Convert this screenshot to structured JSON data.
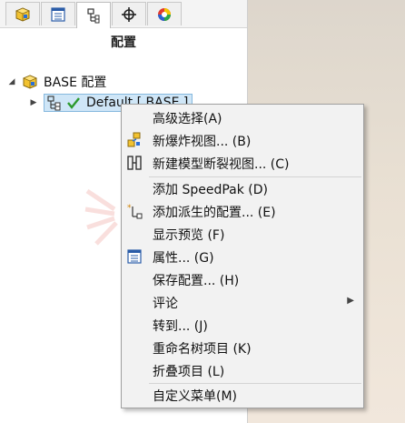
{
  "panel": {
    "title": "配置",
    "tabs": [
      {
        "icon": "feature-manager-icon"
      },
      {
        "icon": "property-manager-icon"
      },
      {
        "icon": "configuration-manager-icon",
        "active": true
      },
      {
        "icon": "dimxpert-icon"
      },
      {
        "icon": "display-manager-icon"
      }
    ]
  },
  "tree": {
    "root_label": "BASE 配置",
    "child_label": "Default [ BASE ]"
  },
  "menu": {
    "items": [
      {
        "label": "高级选择(A)",
        "icon": ""
      },
      {
        "label": "新爆炸视图... (B)",
        "icon": "explode-view-icon"
      },
      {
        "label": "新建模型断裂视图... (C)",
        "icon": "break-view-icon"
      },
      {
        "label": "添加 SpeedPak (D)",
        "icon": ""
      },
      {
        "label": "添加派生的配置... (E)",
        "icon": "derived-config-icon"
      },
      {
        "label": "显示预览 (F)",
        "icon": ""
      },
      {
        "label": "属性... (G)",
        "icon": "properties-icon"
      },
      {
        "label": "保存配置... (H)",
        "icon": ""
      },
      {
        "label": "评论",
        "icon": "",
        "submenu": true
      },
      {
        "label": "转到... (J)",
        "icon": ""
      },
      {
        "label": "重命名树项目 (K)",
        "icon": ""
      },
      {
        "label": "折叠项目 (L)",
        "icon": ""
      },
      {
        "label": "自定义菜单(M)",
        "icon": ""
      }
    ]
  },
  "colors": {
    "selection": "#cfe6f7",
    "menu_bg": "#f2f2f2",
    "check": "#2d9a2d"
  }
}
